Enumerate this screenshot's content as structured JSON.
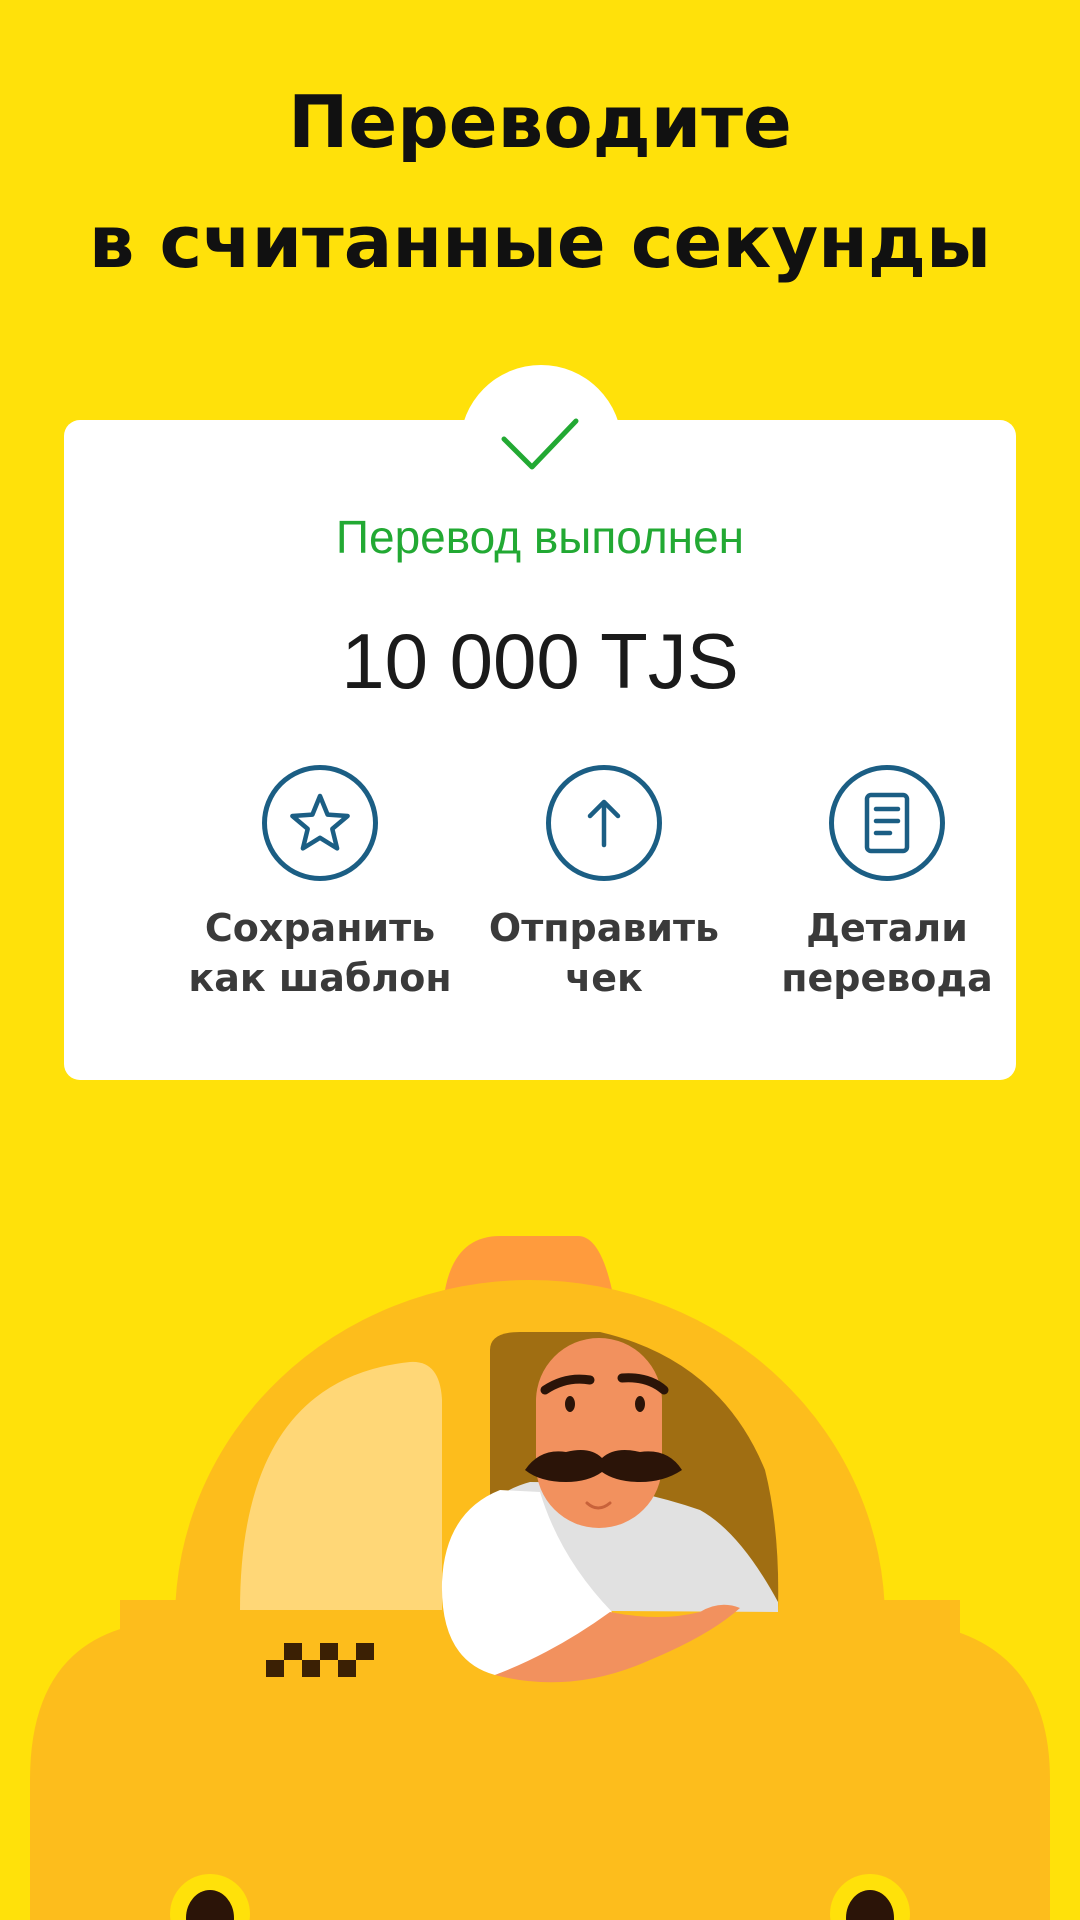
{
  "headline": {
    "line1": "Переводите",
    "line2": "в считанные секунды"
  },
  "card": {
    "status": "Перевод выполнен",
    "amount": "10 000 TJS",
    "actions": [
      {
        "line1": "Сохранить",
        "line2": "как шаблон",
        "icon": "star-icon"
      },
      {
        "line1": "Отправить",
        "line2": "чек",
        "icon": "arrow-up-icon"
      },
      {
        "line1": "Детали",
        "line2": "перевода",
        "icon": "document-icon"
      }
    ]
  },
  "colors": {
    "background": "#FFE10A",
    "success": "#22A933",
    "icon_ring": "#1B5E84",
    "taxi_body": "#FDBD1C",
    "taxi_roof_sign": "#FF9B3D"
  },
  "illustration": "taxi-driver"
}
